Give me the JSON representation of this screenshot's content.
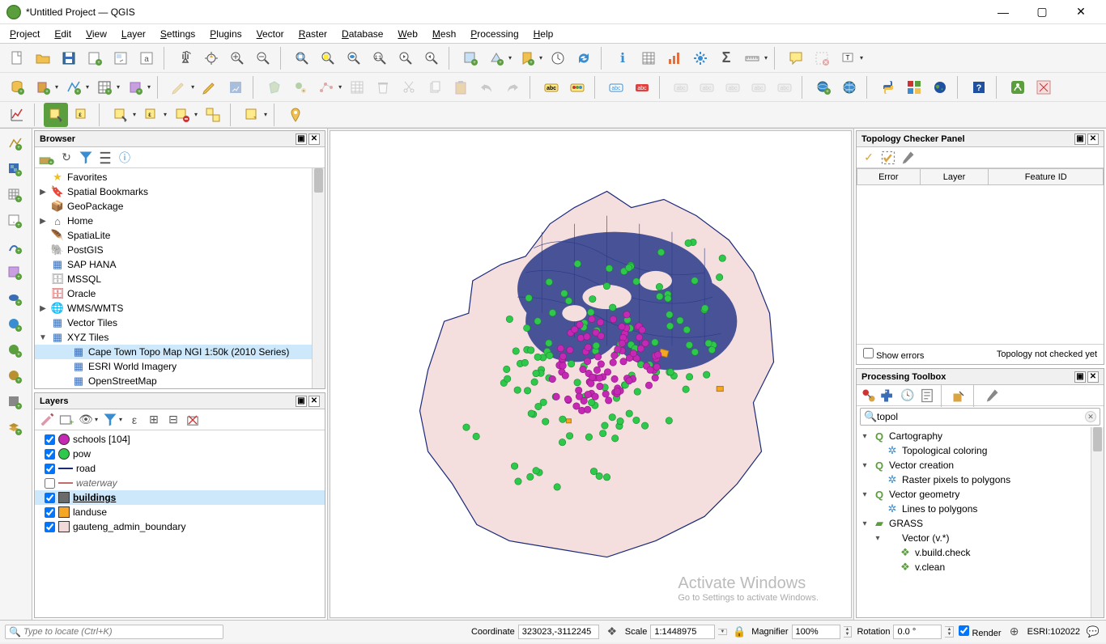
{
  "window": {
    "title": "*Untitled Project — QGIS"
  },
  "menu": [
    "Project",
    "Edit",
    "View",
    "Layer",
    "Settings",
    "Plugins",
    "Vector",
    "Raster",
    "Database",
    "Web",
    "Mesh",
    "Processing",
    "Help"
  ],
  "browser": {
    "title": "Browser",
    "items": [
      {
        "exp": "",
        "icon": "star",
        "label": "Favorites",
        "color": "#f0c020"
      },
      {
        "exp": "▶",
        "icon": "bookmark",
        "label": "Spatial Bookmarks",
        "color": "#888"
      },
      {
        "exp": "",
        "icon": "box",
        "label": "GeoPackage",
        "color": "#d9a441"
      },
      {
        "exp": "▶",
        "icon": "home",
        "label": "Home",
        "color": "#555"
      },
      {
        "exp": "",
        "icon": "feather",
        "label": "SpatiaLite",
        "color": "#3a6db5"
      },
      {
        "exp": "",
        "icon": "elephant",
        "label": "PostGIS",
        "color": "#3a6db5"
      },
      {
        "exp": "",
        "icon": "grid",
        "label": "SAP HANA",
        "color": "#3a6db5"
      },
      {
        "exp": "",
        "icon": "db",
        "label": "MSSQL",
        "color": "#888"
      },
      {
        "exp": "",
        "icon": "db",
        "label": "Oracle",
        "color": "#c33"
      },
      {
        "exp": "▶",
        "icon": "globe",
        "label": "WMS/WMTS",
        "color": "#3a6db5"
      },
      {
        "exp": "",
        "icon": "grid",
        "label": "Vector Tiles",
        "color": "#3a6db5"
      },
      {
        "exp": "▼",
        "icon": "grid",
        "label": "XYZ Tiles",
        "color": "#3a6db5"
      }
    ],
    "xyz_children": [
      "Cape Town Topo Map NGI 1:50k (2010 Series)",
      "ESRI World Imagery",
      "OpenStreetMap"
    ]
  },
  "layers": {
    "title": "Layers",
    "items": [
      {
        "checked": true,
        "swatch": "circle",
        "color": "#c428b5",
        "label": "schools [104]"
      },
      {
        "checked": true,
        "swatch": "circle",
        "color": "#2ec94a",
        "label": "pow"
      },
      {
        "checked": true,
        "swatch": "line",
        "color": "#1b2a7a",
        "label": "road"
      },
      {
        "checked": false,
        "swatch": "line",
        "color": "#c76a6a",
        "label": "waterway",
        "italic": true
      },
      {
        "checked": true,
        "swatch": "rect",
        "color": "#6a6a6a",
        "label": "buildings",
        "selected": true,
        "bold": true,
        "underline": true
      },
      {
        "checked": true,
        "swatch": "rect",
        "color": "#f5a623",
        "label": "landuse"
      },
      {
        "checked": true,
        "swatch": "rect",
        "color": "#f2d9d9",
        "label": "gauteng_admin_boundary"
      }
    ]
  },
  "topology": {
    "title": "Topology Checker Panel",
    "cols": [
      "Error",
      "Layer",
      "Feature ID"
    ],
    "show_errors_label": "Show errors",
    "status": "Topology not checked yet"
  },
  "toolbox": {
    "title": "Processing Toolbox",
    "search": "topol",
    "tree": [
      {
        "type": "group",
        "icon": "Q",
        "label": "Cartography",
        "children": [
          {
            "type": "alg",
            "icon": "gear",
            "label": "Topological coloring",
            "color": "#3a8dd0"
          }
        ]
      },
      {
        "type": "group",
        "icon": "Q",
        "label": "Vector creation",
        "children": [
          {
            "type": "alg",
            "icon": "gear",
            "label": "Raster pixels to polygons",
            "color": "#3a8dd0"
          }
        ]
      },
      {
        "type": "group",
        "icon": "Q",
        "label": "Vector geometry",
        "children": [
          {
            "type": "alg",
            "icon": "gear",
            "label": "Lines to polygons",
            "color": "#3a8dd0"
          }
        ]
      },
      {
        "type": "group",
        "icon": "grass",
        "label": "GRASS",
        "children": [
          {
            "type": "subgroup",
            "label": "Vector (v.*)",
            "children": [
              {
                "type": "alg",
                "icon": "grass",
                "label": "v.build.check",
                "color": "#5a9e3d"
              },
              {
                "type": "alg",
                "icon": "grass",
                "label": "v.clean",
                "color": "#5a9e3d"
              }
            ]
          }
        ]
      }
    ]
  },
  "watermark": {
    "big": "Activate Windows",
    "small": "Go to Settings to activate Windows."
  },
  "status": {
    "locate_placeholder": "Type to locate (Ctrl+K)",
    "coord_label": "Coordinate",
    "coord": "323023,-3112245",
    "scale_label": "Scale",
    "scale": "1:1448975",
    "mag_label": "Magnifier",
    "mag": "100%",
    "rot_label": "Rotation",
    "rot": "0.0 °",
    "render_label": "Render",
    "crs": "ESRI:102022"
  }
}
